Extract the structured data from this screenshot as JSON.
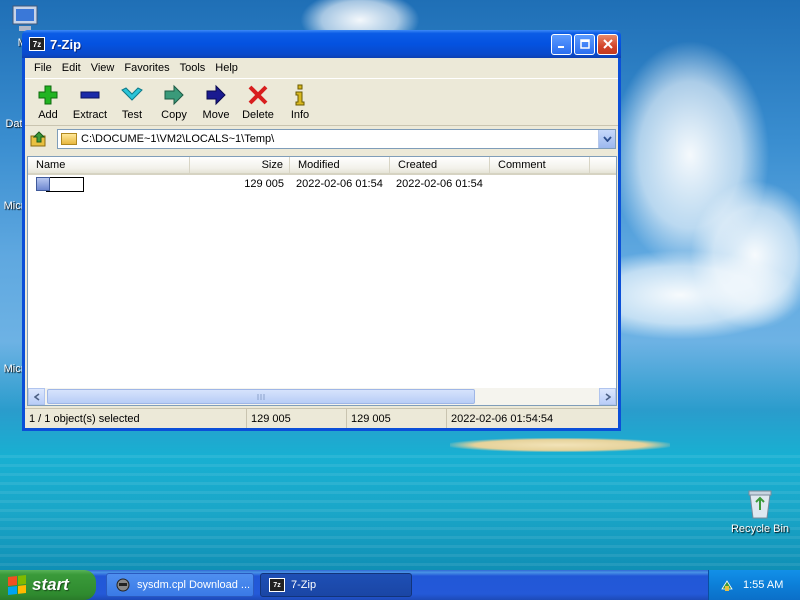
{
  "desktop": {
    "icons": [
      {
        "label": "My",
        "icon": "my-computer-icon"
      },
      {
        "label": "Dat",
        "icon": "document-icon"
      },
      {
        "label": "Micr",
        "icon": "app-icon"
      },
      {
        "label": "Micr",
        "icon": "app-icon"
      },
      {
        "label": "Recycle Bin",
        "icon": "recycle-bin-icon"
      }
    ]
  },
  "window": {
    "title": "7-Zip",
    "title_icon_text": "7z",
    "controls": {
      "minimize": "minimize-icon",
      "maximize": "maximize-icon",
      "close": "close-icon"
    }
  },
  "menu": [
    "File",
    "Edit",
    "View",
    "Favorites",
    "Tools",
    "Help"
  ],
  "toolbar": [
    {
      "label": "Add",
      "icon": "plus-icon",
      "color": "#22b422"
    },
    {
      "label": "Extract",
      "icon": "minus-icon",
      "color": "#1a2aa8"
    },
    {
      "label": "Test",
      "icon": "check-icon",
      "color": "#2ac4d8"
    },
    {
      "label": "Copy",
      "icon": "arrow-right-icon",
      "color": "#3a9a7a"
    },
    {
      "label": "Move",
      "icon": "arrow-right-icon",
      "color": "#1a1a90"
    },
    {
      "label": "Delete",
      "icon": "x-icon",
      "color": "#d81e1e"
    },
    {
      "label": "Info",
      "icon": "info-icon",
      "color": "#d8b820"
    }
  ],
  "address": {
    "path": "C:\\DOCUME~1\\VM2\\LOCALS~1\\Temp\\"
  },
  "columns": [
    "Name",
    "Size",
    "Modified",
    "Created",
    "Comment"
  ],
  "rows": [
    {
      "name": "",
      "size": "129 005",
      "modified": "2022-02-06 01:54",
      "created": "2022-02-06 01:54",
      "comment": ""
    }
  ],
  "status": {
    "selected": "1 / 1 object(s) selected",
    "size": "129 005",
    "packed": "129 005",
    "modified": "2022-02-06 01:54:54"
  },
  "taskbar": {
    "start_label": "start",
    "tasks": [
      {
        "label": "sysdm.cpl Download ...",
        "active": false
      },
      {
        "label": "7-Zip",
        "active": true
      }
    ],
    "clock": "1:55 AM"
  }
}
